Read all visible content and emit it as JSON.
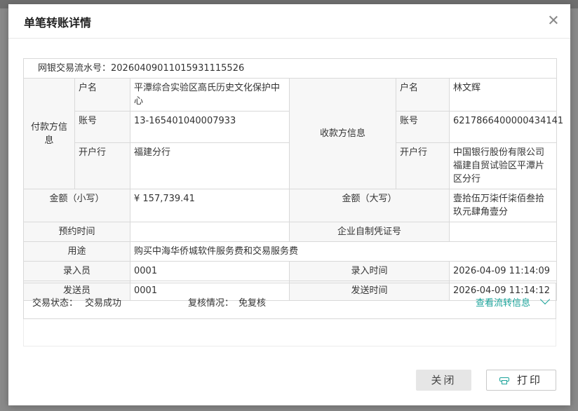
{
  "dialog": {
    "title": "单笔转账详情",
    "serial_label": "网银交易流水号：",
    "serial_no": "20260409011015931115526",
    "payer": {
      "group_label": "付款方信息",
      "name_label": "户名",
      "name": "平潭综合实验区高氏历史文化保护中心",
      "account_label": "账号",
      "account": "13-165401040007933",
      "bank_label": "开户行",
      "bank": "福建分行"
    },
    "payee": {
      "group_label": "收款方信息",
      "name_label": "户名",
      "name": "林文辉",
      "account_label": "账号",
      "account": "6217866400000434141",
      "bank_label": "开户行",
      "bank": "中国银行股份有限公司福建自贸试验区平潭片区分行"
    },
    "amount_small_label": "金额（小写）",
    "amount_small": "¥ 157,739.41",
    "amount_big_label": "金额（大写）",
    "amount_big": "壹拾伍万柒仟柒佰叁拾玖元肆角壹分",
    "scheduled_time_label": "预约时间",
    "scheduled_time": "",
    "voucher_label": "企业自制凭证号",
    "voucher": "",
    "purpose_label": "用途",
    "purpose": "购买中海华侨城软件服务费和交易服务费",
    "entry_clerk_label": "录入员",
    "entry_clerk": "0001",
    "entry_time_label": "录入时间",
    "entry_time": "2026-04-09 11:14:09",
    "sender_label": "发送员",
    "sender": "0001",
    "send_time_label": "发送时间",
    "send_time": "2026-04-09 11:14:12",
    "status_label": "交易状态：",
    "status": "交易成功",
    "review_label": "复核情况：",
    "review": "免复核",
    "flow_link": "查看流转信息",
    "close_button": "关闭",
    "print_button": "打印"
  },
  "colors": {
    "accent": "#1aa39a",
    "overlay": "#7d7d7d"
  }
}
